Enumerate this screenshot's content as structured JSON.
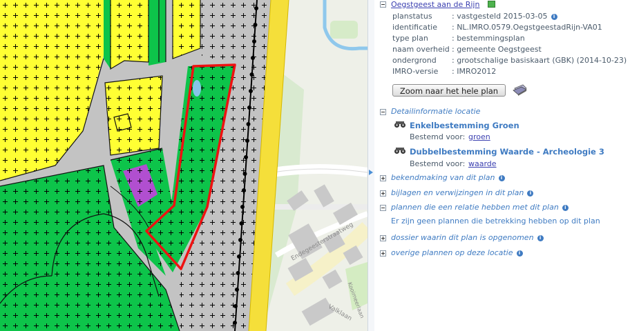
{
  "plan": {
    "name": "Oegstgeest aan de Rijn",
    "fields": [
      {
        "key": "planstatus",
        "value": ": vastgesteld 2015-03-05",
        "has_info": true
      },
      {
        "key": "identificatie",
        "value": ": NL.IMRO.0579.OegstgeestadRijn-VA01",
        "has_info": false
      },
      {
        "key": "type plan",
        "value": ": bestemmingsplan",
        "has_info": false
      },
      {
        "key": "naam overheid",
        "value": ": gemeente Oegstgeest",
        "has_info": false
      },
      {
        "key": "ondergrond",
        "value": ": grootschalige basiskaart (GBK) (2014-10-23)",
        "has_info": false
      },
      {
        "key": "IMRO-versie",
        "value": ": IMRO2012",
        "has_info": false
      }
    ],
    "zoom_button": "Zoom naar het hele plan"
  },
  "detail": {
    "title": "Detailinformatie locatie",
    "items": [
      {
        "title": "Enkelbestemming Groen",
        "label": "Bestemd voor:",
        "link": "groen"
      },
      {
        "title": "Dubbelbestemming Waarde - Archeologie 3",
        "label": "Bestemd voor:",
        "link": "waarde"
      }
    ]
  },
  "sections": [
    {
      "label": "bekendmaking van dit plan",
      "expanded": false
    },
    {
      "label": "bijlagen en verwijzingen in dit plan",
      "expanded": false
    },
    {
      "label": "plannen die een relatie hebben met dit plan",
      "expanded": true
    },
    {
      "label": "dossier waarin dit plan is opgenomen",
      "expanded": false
    },
    {
      "label": "overige plannen op deze locatie",
      "expanded": false
    }
  ],
  "relation_text": "Er zijn geen plannen die betrekking hebben op dit plan",
  "map_labels": {
    "street1": "Endegeesterstraatweg",
    "street2": "Valklaan",
    "street3": "Kooimeerlaan"
  },
  "colors": {
    "groen": "#0dc44a",
    "wonen": "#ffff33",
    "verkeer": "#c3c3c3",
    "maatschappelijk": "#b14fd0",
    "selectie": "#ee1111",
    "weg": "#f5df3a"
  }
}
